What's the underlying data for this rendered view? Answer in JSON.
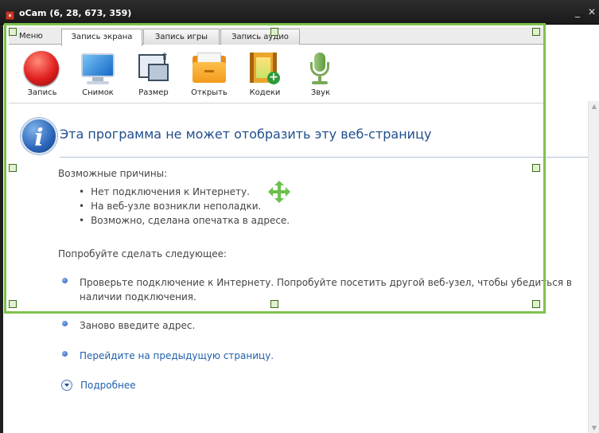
{
  "window": {
    "title": "oCam (6, 28, 673, 359)",
    "minimize_glyph": "_",
    "close_glyph": "✕",
    "icon": "ocam-app-icon"
  },
  "ocam": {
    "tabs": [
      {
        "label": "Меню",
        "active": false
      },
      {
        "label": "Запись экрана",
        "active": true
      },
      {
        "label": "Запись игры",
        "active": false
      },
      {
        "label": "Запись аудио",
        "active": false
      }
    ],
    "tools": [
      {
        "label": "Запись",
        "icon": "record-icon"
      },
      {
        "label": "Снимок",
        "icon": "monitor-snapshot-icon"
      },
      {
        "label": "Размер",
        "icon": "resize-icon"
      },
      {
        "label": "Открыть",
        "icon": "folder-icon"
      },
      {
        "label": "Кодеки",
        "icon": "codec-film-icon"
      },
      {
        "label": "Звук",
        "icon": "microphone-icon"
      }
    ],
    "accent_color": "#7ec24d"
  },
  "error_page": {
    "title": "Эта программа не может отобразить эту веб-страницу",
    "reasons_heading": "Возможные причины:",
    "reasons": [
      "Нет подключения к Интернету.",
      "На веб-узле возникли неполадки.",
      "Возможно, сделана опечатка в адресе."
    ],
    "try_heading": "Попробуйте сделать следующее:",
    "suggestions": [
      "Проверьте подключение к Интернету. Попробуйте посетить другой веб-узел, чтобы убедиться в наличии подключения.",
      "Заново введите адрес.",
      "Перейдите на предыдущую страницу."
    ],
    "more_label": "Подробнее",
    "link_color": "#1f5fae",
    "title_color": "#1f4d8c"
  }
}
